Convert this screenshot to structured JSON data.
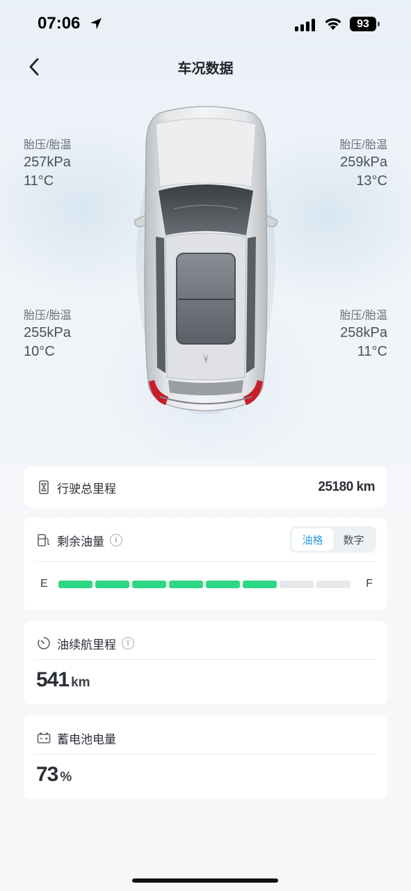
{
  "status_bar": {
    "time": "07:06",
    "battery": "93"
  },
  "header": {
    "title": "车况数据"
  },
  "tires": {
    "front_left": {
      "label": "胎压/胎温",
      "pressure": "257kPa",
      "temp": "11°C"
    },
    "front_right": {
      "label": "胎压/胎温",
      "pressure": "259kPa",
      "temp": "13°C"
    },
    "rear_left": {
      "label": "胎压/胎温",
      "pressure": "255kPa",
      "temp": "10°C"
    },
    "rear_right": {
      "label": "胎压/胎温",
      "pressure": "258kPa",
      "temp": "11°C"
    }
  },
  "odometer": {
    "label": "行驶总里程",
    "value": "25180 km",
    "icon": "hourglass-icon"
  },
  "fuel": {
    "label": "剩余油量",
    "icon": "fuel-pump-icon",
    "toggle": {
      "options": [
        "油格",
        "数字"
      ],
      "selected": "油格"
    },
    "gauge": {
      "empty_label": "E",
      "full_label": "F",
      "total_bars": 8,
      "filled_bars": 6
    },
    "colors": {
      "filled": "#2dd785",
      "empty": "#e6e8eb",
      "active_tab": "#2f9be0"
    }
  },
  "range": {
    "label": "油续航里程",
    "icon": "timer-icon",
    "value": "541",
    "unit": "km"
  },
  "battery_12v": {
    "label": "蓄电池电量",
    "icon": "car-battery-icon",
    "value": "73",
    "unit": "%"
  }
}
